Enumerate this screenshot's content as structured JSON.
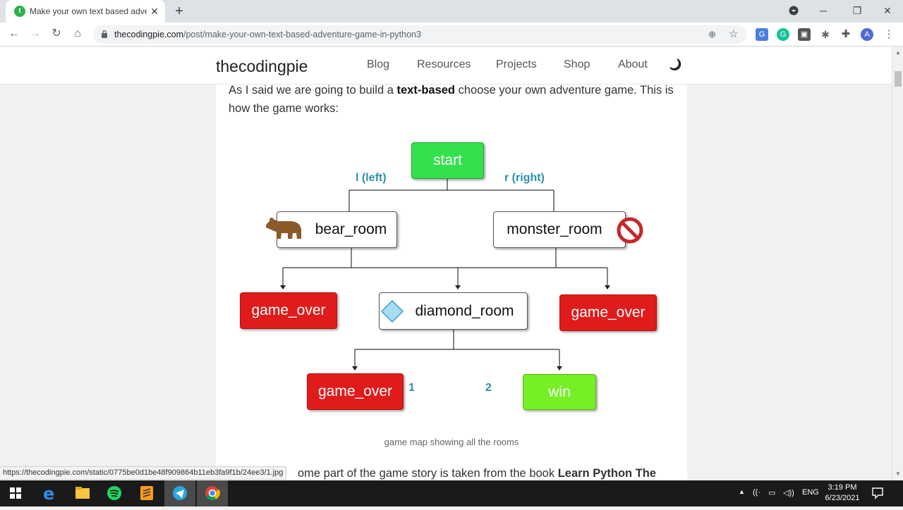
{
  "browser": {
    "tab_title": "Make your own text based adven",
    "url_host": "thecodingpie.com",
    "url_path": "/post/make-your-own-text-based-adventure-game-in-python3",
    "profile_initial": "A"
  },
  "site": {
    "brand": "thecodingpie",
    "nav": [
      "Blog",
      "Resources",
      "Projects",
      "Shop",
      "About"
    ]
  },
  "article": {
    "intro_pre": "As I said we are going to build a ",
    "intro_bold": "text-based",
    "intro_post": " choose your own adventure game. This is how the game works:",
    "caption": "game map showing all the rooms",
    "bottom_pre": "ome part of the game story is taken from the book ",
    "bottom_bold": "Learn Python The"
  },
  "diagram": {
    "start": "start",
    "left_label": "l (left)",
    "right_label": "r (right)",
    "bear_room": "bear_room",
    "monster_room": "monster_room",
    "diamond_room": "diamond_room",
    "game_over": "game_over",
    "win": "win",
    "opt1": "1",
    "opt2": "2",
    "colors": {
      "start": "#33e14d",
      "game_over": "#e01b1b",
      "win": "#76ef27",
      "edge_label": "#2e8fae"
    }
  },
  "status_url": "https://thecodingpie.com/static/0775be0d1be48f909864b11eb3fa9f1b/24ee3/1.jpg",
  "taskbar": {
    "lang": "ENG",
    "time": "3:19 PM",
    "date": "6/23/2021"
  }
}
